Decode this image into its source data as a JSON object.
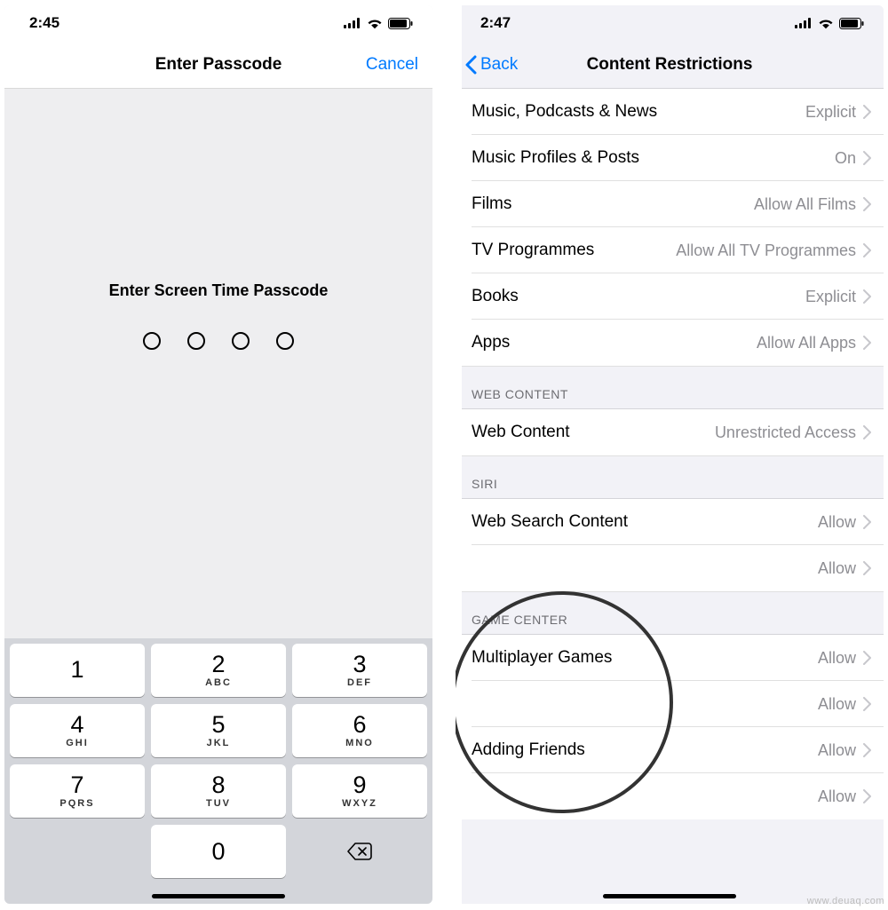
{
  "left": {
    "time": "2:45",
    "nav": {
      "title": "Enter Passcode",
      "cancel": "Cancel"
    },
    "prompt": "Enter Screen Time Passcode",
    "keys": [
      {
        "n": "1",
        "l": ""
      },
      {
        "n": "2",
        "l": "ABC"
      },
      {
        "n": "3",
        "l": "DEF"
      },
      {
        "n": "4",
        "l": "GHI"
      },
      {
        "n": "5",
        "l": "JKL"
      },
      {
        "n": "6",
        "l": "MNO"
      },
      {
        "n": "7",
        "l": "PQRS"
      },
      {
        "n": "8",
        "l": "TUV"
      },
      {
        "n": "9",
        "l": "WXYZ"
      },
      {
        "n": "0",
        "l": ""
      }
    ]
  },
  "right": {
    "time": "2:47",
    "nav": {
      "back": "Back",
      "title": "Content Restrictions"
    },
    "rows1": [
      {
        "label": "Music, Podcasts & News",
        "value": "Explicit"
      },
      {
        "label": "Music Profiles & Posts",
        "value": "On"
      },
      {
        "label": "Films",
        "value": "Allow All Films"
      },
      {
        "label": "TV Programmes",
        "value": "Allow All TV Programmes"
      },
      {
        "label": "Books",
        "value": "Explicit"
      },
      {
        "label": "Apps",
        "value": "Allow All Apps"
      }
    ],
    "section_web": "WEB CONTENT",
    "rows2": [
      {
        "label": "Web Content",
        "value": "Unrestricted Access"
      }
    ],
    "section_siri": "SIRI",
    "rows3": [
      {
        "label": "Web Search Content",
        "value": "Allow"
      },
      {
        "label": "",
        "value": "Allow"
      }
    ],
    "section_game": "GAME CENTER",
    "rows4": [
      {
        "label": "Multiplayer Games",
        "value": "Allow"
      },
      {
        "label": "",
        "value": "Allow"
      },
      {
        "label": "Adding Friends",
        "value": "Allow"
      },
      {
        "label": "",
        "value": "Allow"
      }
    ]
  },
  "watermark": "www.deuaq.com"
}
